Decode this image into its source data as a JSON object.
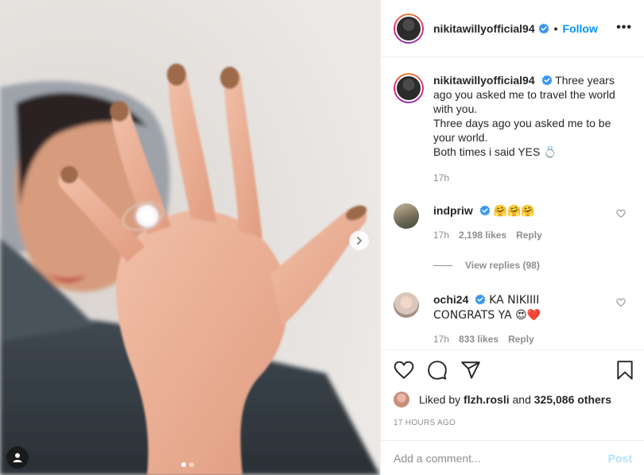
{
  "post": {
    "author": "nikitawillyofficial94",
    "follow_label": "Follow",
    "more_label": "•••",
    "bullet": "•",
    "caption": {
      "line1": "Three years ago you asked me to travel the world with you.",
      "line2": "Three days ago you asked me to be your world.",
      "line3": "Both times i said YES",
      "line3_emoji": "💍",
      "time": "17h"
    },
    "comments": [
      {
        "username": "indpriw",
        "text": "🤗🤗🤗",
        "time": "17h",
        "likes": "2,198 likes",
        "reply": "Reply"
      },
      {
        "username": "ochi24",
        "text": "KA NIKIIII CONGRATS YA 😍❤️",
        "time": "17h",
        "likes": "833 likes",
        "reply": "Reply"
      }
    ],
    "view_replies": "View replies (98)",
    "liked_by_prefix": "Liked by",
    "liked_by_user": "flzh.rosli",
    "liked_by_and": "and",
    "liked_by_count": "325,086 others",
    "posted_ago": "17 HOURS AGO",
    "add_comment_placeholder": "Add a comment...",
    "post_label": "Post",
    "carousel": {
      "current": 1,
      "total": 2
    }
  },
  "icons": {
    "verified": "verified-badge-icon",
    "like": "heart-icon",
    "comment": "comment-icon",
    "share": "paper-plane-icon",
    "save": "bookmark-icon",
    "next": "chevron-right-icon",
    "tagged": "user-tag-icon"
  },
  "colors": {
    "accent": "#0095f6",
    "verified": "#3897f0",
    "muted": "#8e8e8e",
    "text": "#262626",
    "post_disabled": "#b2dffc"
  }
}
